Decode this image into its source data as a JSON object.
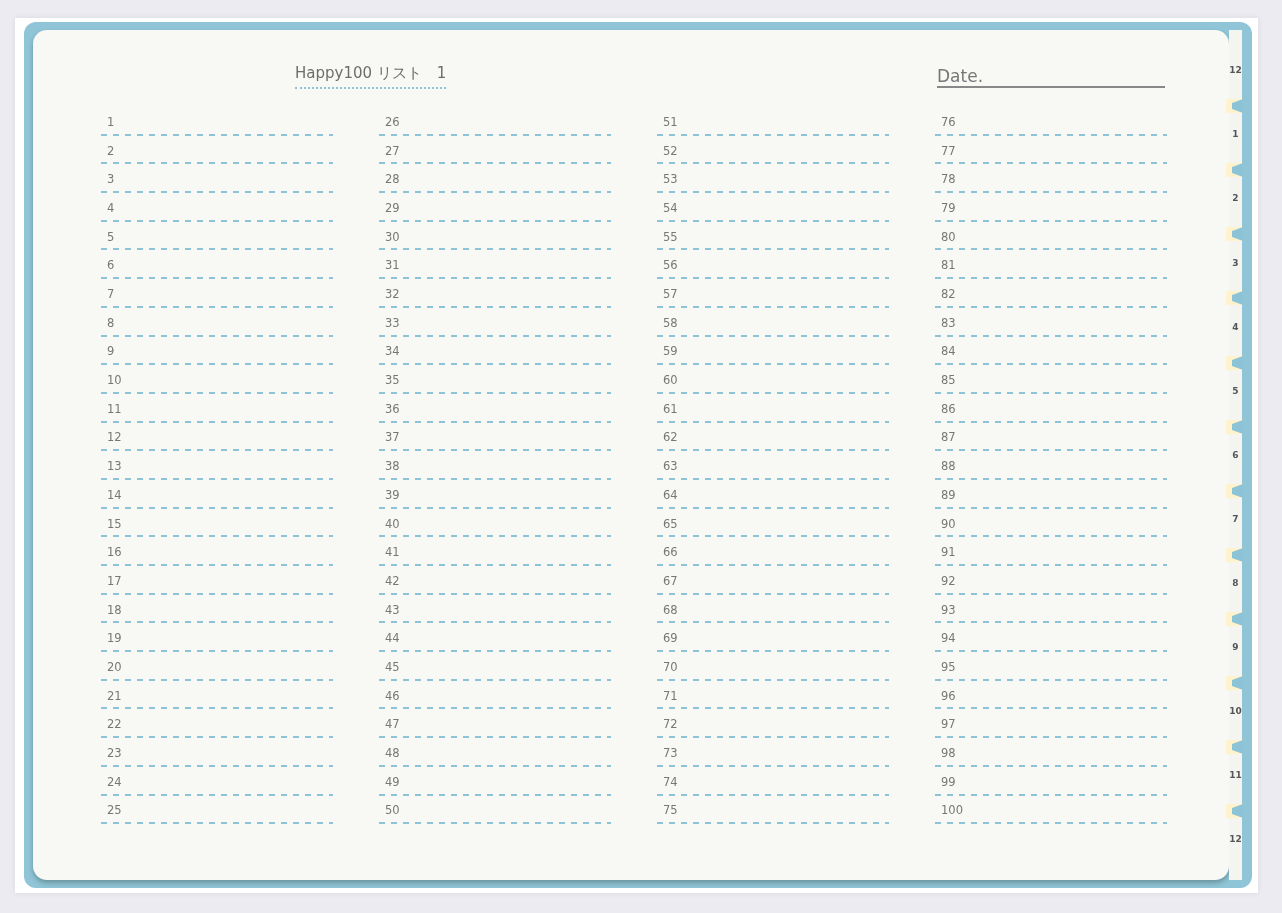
{
  "title": "Happy100 リスト　1",
  "date_label": "Date.",
  "columns": [
    [
      "1",
      "2",
      "3",
      "4",
      "5",
      "6",
      "7",
      "8",
      "9",
      "10",
      "11",
      "12",
      "13",
      "14",
      "15",
      "16",
      "17",
      "18",
      "19",
      "20",
      "21",
      "22",
      "23",
      "24",
      "25"
    ],
    [
      "26",
      "27",
      "28",
      "29",
      "30",
      "31",
      "32",
      "33",
      "34",
      "35",
      "36",
      "37",
      "38",
      "39",
      "40",
      "41",
      "42",
      "43",
      "44",
      "45",
      "46",
      "47",
      "48",
      "49",
      "50"
    ],
    [
      "51",
      "52",
      "53",
      "54",
      "55",
      "56",
      "57",
      "58",
      "59",
      "60",
      "61",
      "62",
      "63",
      "64",
      "65",
      "66",
      "67",
      "68",
      "69",
      "70",
      "71",
      "72",
      "73",
      "74",
      "75"
    ],
    [
      "76",
      "77",
      "78",
      "79",
      "80",
      "81",
      "82",
      "83",
      "84",
      "85",
      "86",
      "87",
      "88",
      "89",
      "90",
      "91",
      "92",
      "93",
      "94",
      "95",
      "96",
      "97",
      "98",
      "99",
      "100"
    ]
  ],
  "month_tabs": [
    "12",
    "1",
    "2",
    "3",
    "4",
    "5",
    "6",
    "7",
    "8",
    "9",
    "10",
    "11",
    "12"
  ]
}
